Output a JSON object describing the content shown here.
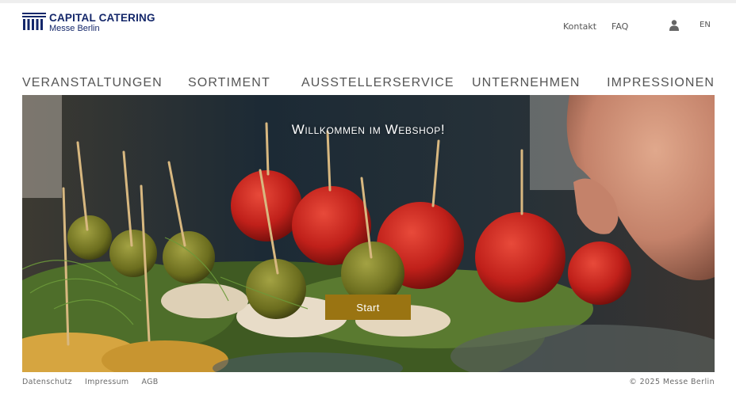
{
  "header": {
    "brand_name": "CAPITAL CATERING",
    "brand_sub": "Messe Berlin",
    "utility": {
      "kontakt": "Kontakt",
      "faq": "FAQ",
      "user_icon": "user-icon",
      "language": "EN"
    }
  },
  "nav": {
    "items": [
      {
        "label": "VERANSTALTUNGEN"
      },
      {
        "label": "SORTIMENT"
      },
      {
        "label": "AUSSTELLERSERVICE"
      },
      {
        "label": "UNTERNEHMEN"
      },
      {
        "label": "IMPRESSIONEN"
      }
    ]
  },
  "hero": {
    "title": "Willkommen im Webshop!",
    "cta_label": "Start",
    "accent_color": "#9a7412"
  },
  "footer": {
    "links": [
      "Datenschutz",
      "Impressum",
      "AGB"
    ],
    "copyright": "© 2025 Messe Berlin"
  },
  "colors": {
    "brand": "#14276a",
    "nav_text": "#555555",
    "footer_text": "#6b6b6b"
  }
}
